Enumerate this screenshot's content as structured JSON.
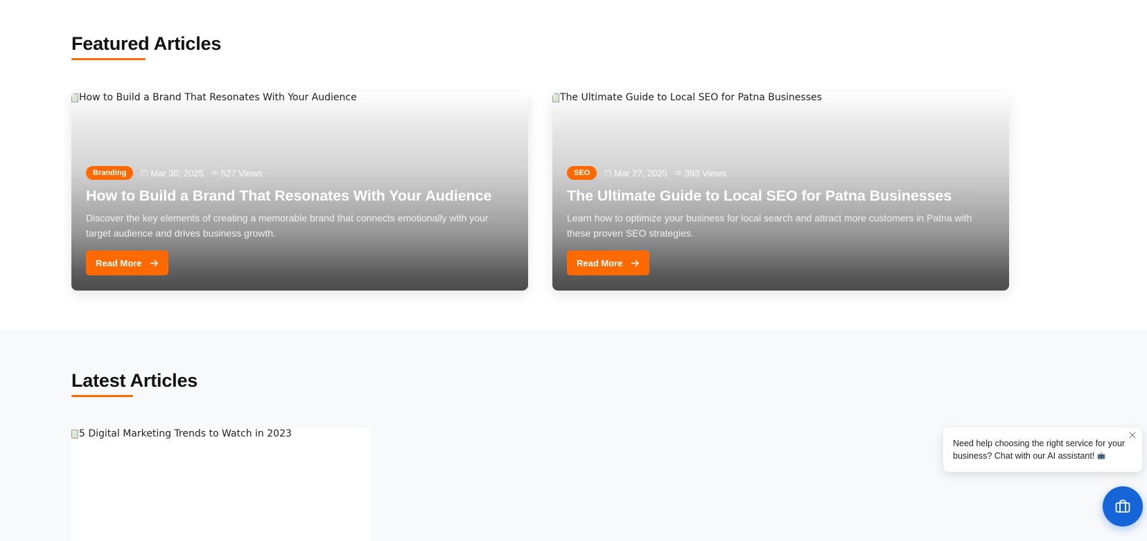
{
  "featured": {
    "title": "Featured Articles",
    "articles": [
      {
        "image_alt": "How to Build a Brand That Resonates With Your Audience",
        "category": "Branding",
        "date": "Mar 30, 2025",
        "views": "527 Views",
        "title": "How to Build a Brand That Resonates With Your Audience",
        "description": "Discover the key elements of creating a memorable brand that connects emotionally with your target audience and drives business growth.",
        "cta": "Read More"
      },
      {
        "image_alt": "The Ultimate Guide to Local SEO for Patna Businesses",
        "category": "SEO",
        "date": "Mar 27, 2025",
        "views": "393 Views",
        "title": "The Ultimate Guide to Local SEO for Patna Businesses",
        "description": "Learn how to optimize your business for local search and attract more customers in Patna with these proven SEO strategies.",
        "cta": "Read More"
      }
    ]
  },
  "latest": {
    "title": "Latest Articles",
    "articles": [
      {
        "image_alt": "5 Digital Marketing Trends to Watch in 2023"
      }
    ]
  },
  "chat": {
    "prompt": "Need help choosing the right service for your business? Chat with our AI assistant!"
  },
  "colors": {
    "accent": "#ff6a00",
    "chat_button": "#1565d8",
    "latest_background": "#f8f9fa"
  },
  "icons": {
    "calendar": "calendar-icon",
    "views": "eye-icon",
    "arrow": "arrow-right-icon",
    "close": "close-icon",
    "chat": "briefcase-icon",
    "robot": "robot-icon"
  }
}
